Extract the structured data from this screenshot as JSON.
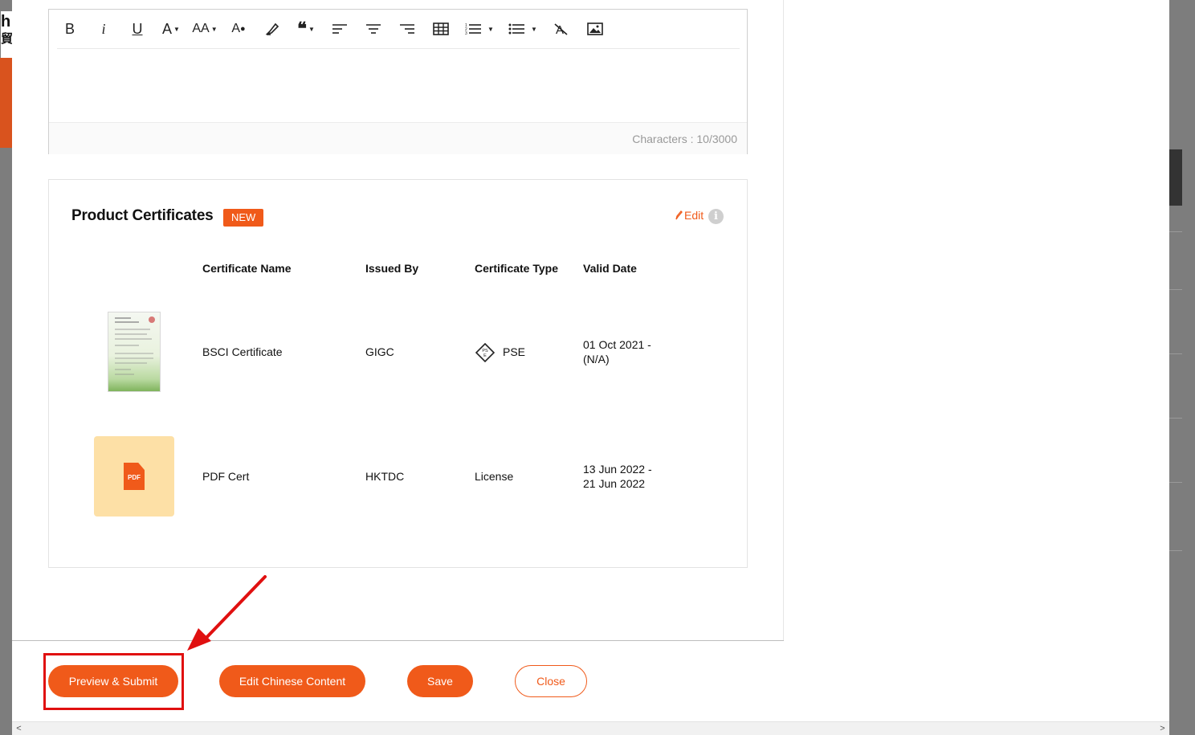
{
  "background": {
    "logo_char": "h",
    "logo_char2": "貿"
  },
  "editor": {
    "toolbar": [
      {
        "name": "bold-button",
        "label": "B"
      },
      {
        "name": "italic-button",
        "label": "i"
      },
      {
        "name": "underline-button",
        "label": "U"
      },
      {
        "name": "font-color-button",
        "label": "A"
      },
      {
        "name": "font-size-button",
        "label": "AA"
      },
      {
        "name": "text-color-button",
        "label": "A"
      },
      {
        "name": "highlight-button",
        "label": ""
      },
      {
        "name": "quote-button",
        "label": "66"
      },
      {
        "name": "align-left-button",
        "label": ""
      },
      {
        "name": "align-center-button",
        "label": ""
      },
      {
        "name": "align-right-button",
        "label": ""
      },
      {
        "name": "table-button",
        "label": ""
      },
      {
        "name": "ordered-list-button",
        "label": ""
      },
      {
        "name": "bullet-list-button",
        "label": ""
      },
      {
        "name": "clear-format-button",
        "label": ""
      },
      {
        "name": "insert-image-button",
        "label": ""
      }
    ],
    "char_count": "Characters : 10/3000"
  },
  "certificates": {
    "title": "Product Certificates",
    "badge": "NEW",
    "edit_label": "Edit",
    "columns": [
      "Certificate Name",
      "Issued By",
      "Certificate Type",
      "Valid Date"
    ],
    "rows": [
      {
        "name": "BSCI Certificate",
        "issued_by": "GIGC",
        "type": "PSE",
        "valid_from": "01 Oct 2021 -",
        "valid_to": "(N/A)"
      },
      {
        "name": "PDF Cert",
        "issued_by": "HKTDC",
        "type": "License",
        "valid_from": "13 Jun 2022 -",
        "valid_to": "21 Jun 2022"
      }
    ],
    "pdf_label": "PDF"
  },
  "footer": {
    "preview_submit": "Preview & Submit",
    "edit_chinese": "Edit Chinese Content",
    "save": "Save",
    "close": "Close"
  },
  "colors": {
    "accent": "#f05a1a",
    "annotation": "#e01010"
  },
  "scrollbar": {
    "left_arrow": "<",
    "right_arrow": ">"
  }
}
